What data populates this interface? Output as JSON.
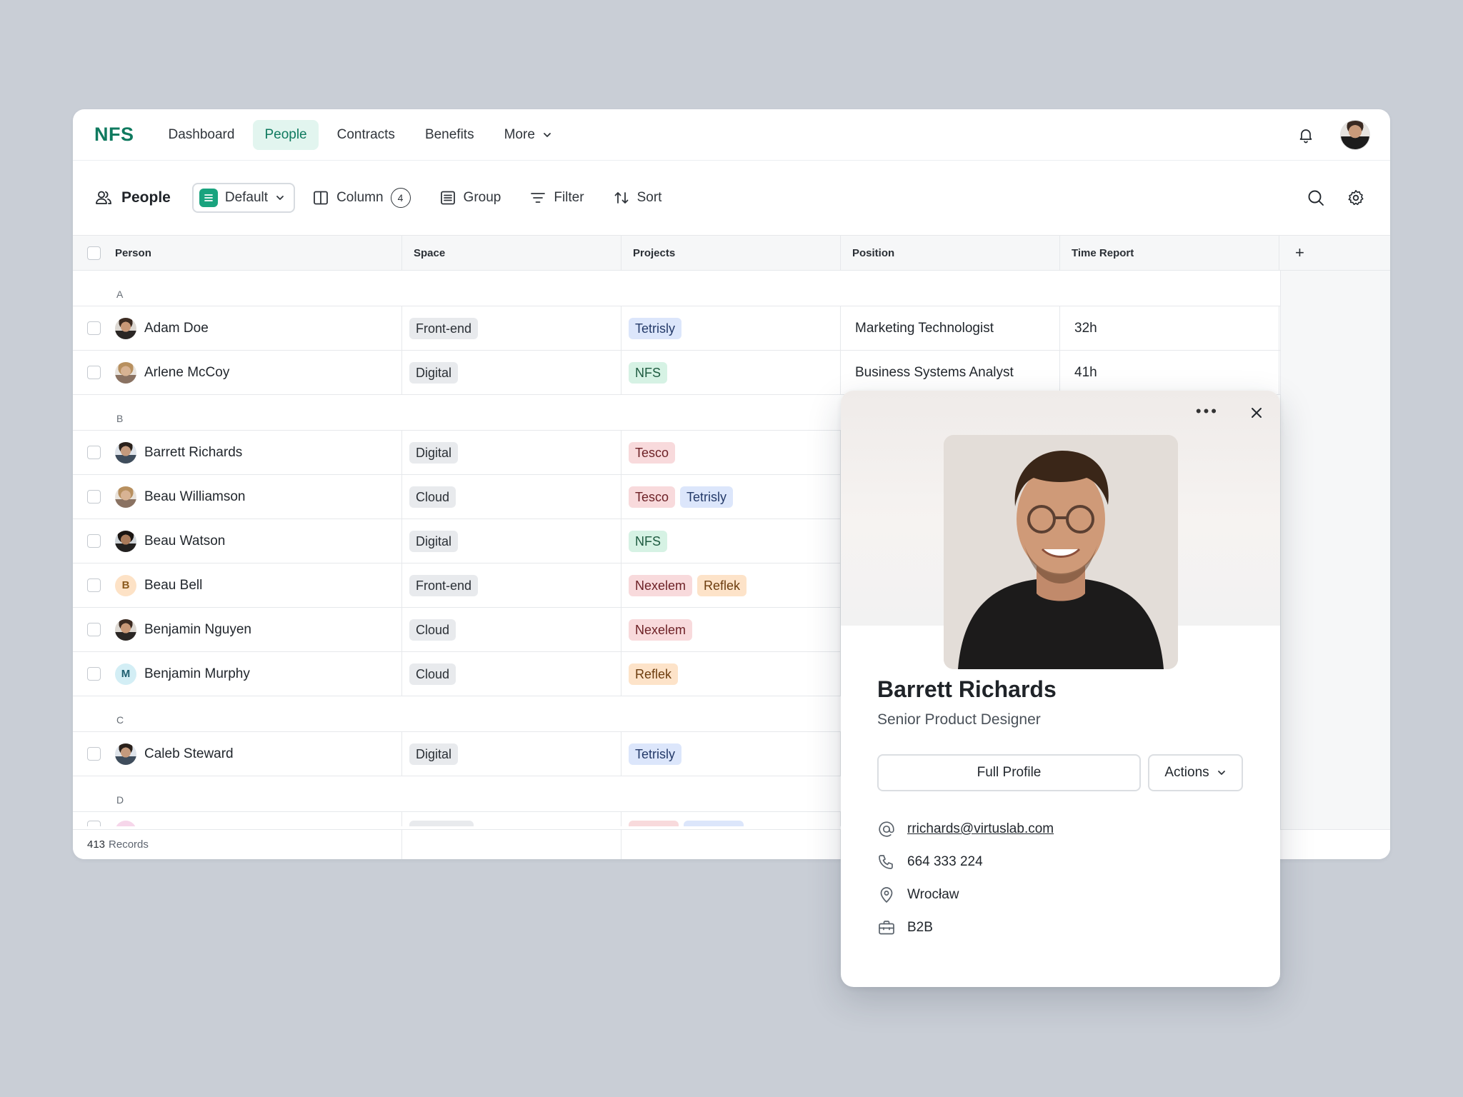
{
  "nav": {
    "logo": "NFS",
    "items": [
      {
        "label": "Dashboard"
      },
      {
        "label": "People"
      },
      {
        "label": "Contracts"
      },
      {
        "label": "Benefits"
      },
      {
        "label": "More"
      }
    ]
  },
  "toolbar": {
    "title": "People",
    "view": "Default",
    "column_label": "Column",
    "column_count": "4",
    "group_label": "Group",
    "filter_label": "Filter",
    "sort_label": "Sort"
  },
  "table": {
    "headers": [
      "Person",
      "Space",
      "Projects",
      "Position",
      "Time Report"
    ],
    "add_column": "+",
    "groups": {
      "a": "A",
      "b": "B",
      "c": "C",
      "d": "D"
    },
    "rows": [
      {
        "name": "Adam Doe",
        "space": "Front-end",
        "projects": [
          "Tetrisly"
        ],
        "position": "Marketing Technologist",
        "time": "32h"
      },
      {
        "name": "Arlene McCoy",
        "space": "Digital",
        "projects": [
          "NFS"
        ],
        "position": "Business Systems Analyst",
        "time": "41h"
      },
      {
        "name": "Barrett Richards",
        "space": "Digital",
        "projects": [
          "Tesco"
        ],
        "position": "",
        "time": ""
      },
      {
        "name": "Beau Williamson",
        "space": "Cloud",
        "projects": [
          "Tesco",
          "Tetrisly"
        ],
        "position": "",
        "time": ""
      },
      {
        "name": "Beau Watson",
        "space": "Digital",
        "projects": [
          "NFS"
        ],
        "position": "",
        "time": ""
      },
      {
        "name": "Beau Bell",
        "initial": "B",
        "space": "Front-end",
        "projects": [
          "Nexelem",
          "Reflek"
        ],
        "position": "",
        "time": ""
      },
      {
        "name": "Benjamin Nguyen",
        "space": "Cloud",
        "projects": [
          "Nexelem"
        ],
        "position": "",
        "time": ""
      },
      {
        "name": "Benjamin Murphy",
        "initial": "M",
        "space": "Cloud",
        "projects": [
          "Reflek"
        ],
        "position": "",
        "time": ""
      },
      {
        "name": "Caleb Steward",
        "space": "Digital",
        "projects": [
          "Tetrisly"
        ],
        "position": "",
        "time": ""
      }
    ],
    "footer_count": "413",
    "footer_label": "Records"
  },
  "profile": {
    "name": "Barrett Richards",
    "role": "Senior Product Designer",
    "full_profile": "Full Profile",
    "actions": "Actions",
    "email": "rrichards@virtuslab.com",
    "phone": "664 333 224",
    "location": "Wrocław",
    "contract": "B2B"
  },
  "colors": {
    "brand": "#0f7a5f",
    "background": "#c9ced6"
  }
}
